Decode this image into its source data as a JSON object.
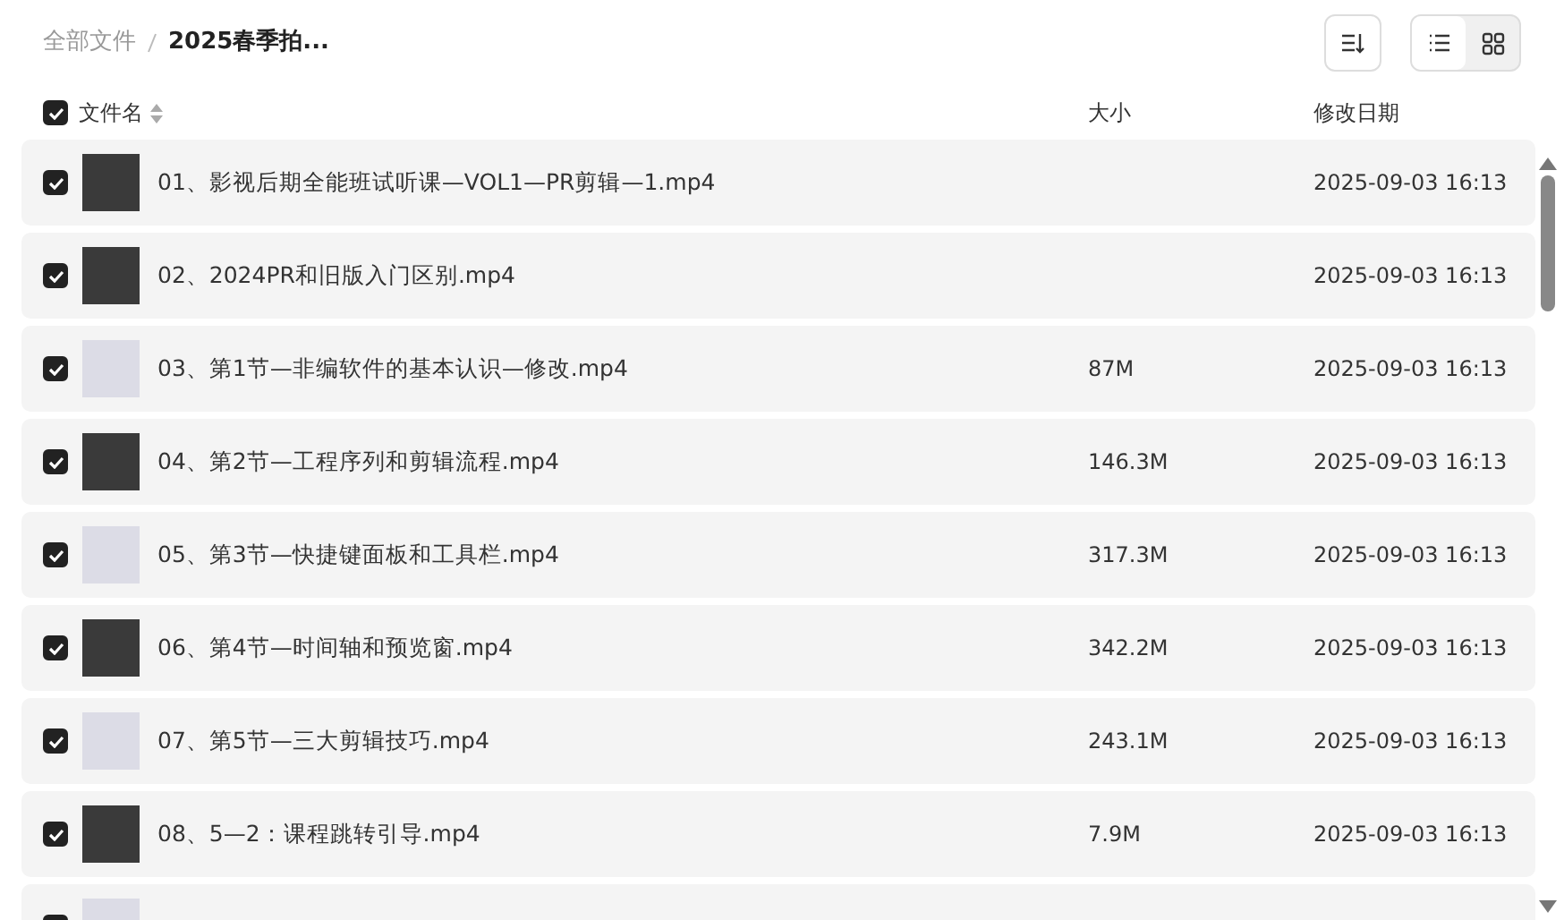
{
  "breadcrumb": [
    {
      "label": "全部文件",
      "current": false
    },
    {
      "label": "2025春季拍...",
      "current": true
    }
  ],
  "toolbar": {
    "view_modes": [
      {
        "kind": "list",
        "selected": true
      },
      {
        "kind": "grid",
        "selected": false
      }
    ]
  },
  "table": {
    "select_all_checked": true,
    "columns": [
      "文件名",
      "大小",
      "修改日期"
    ],
    "rows": [
      {
        "checked": true,
        "name": "01、影视后期全能班试听课—VOL1—PR剪辑—1.mp4",
        "date": "2025-09-03 16:13"
      },
      {
        "checked": true,
        "name": "02、2024PR和旧版入门区别.mp4",
        "date": "2025-09-03 16:13"
      },
      {
        "checked": true,
        "name": "03、第1节—非编软件的基本认识—修改.mp4",
        "size": "87M",
        "date": "2025-09-03 16:13"
      },
      {
        "checked": true,
        "name": "04、第2节—工程序列和剪辑流程.mp4",
        "size": "146.3M",
        "date": "2025-09-03 16:13"
      },
      {
        "checked": true,
        "name": "05、第3节—快捷键面板和工具栏.mp4",
        "size": "317.3M",
        "date": "2025-09-03 16:13"
      },
      {
        "checked": true,
        "name": "06、第4节—时间轴和预览窗.mp4",
        "size": "342.2M",
        "date": "2025-09-03 16:13"
      },
      {
        "checked": true,
        "name": "07、第5节—三大剪辑技巧.mp4",
        "size": "243.1M",
        "date": "2025-09-03 16:13"
      },
      {
        "checked": true,
        "name": "08、5—2：课程跳转引导.mp4",
        "size": "7.9M",
        "date": "2025-09-03 16:13"
      },
      {
        "checked": true
      }
    ]
  }
}
